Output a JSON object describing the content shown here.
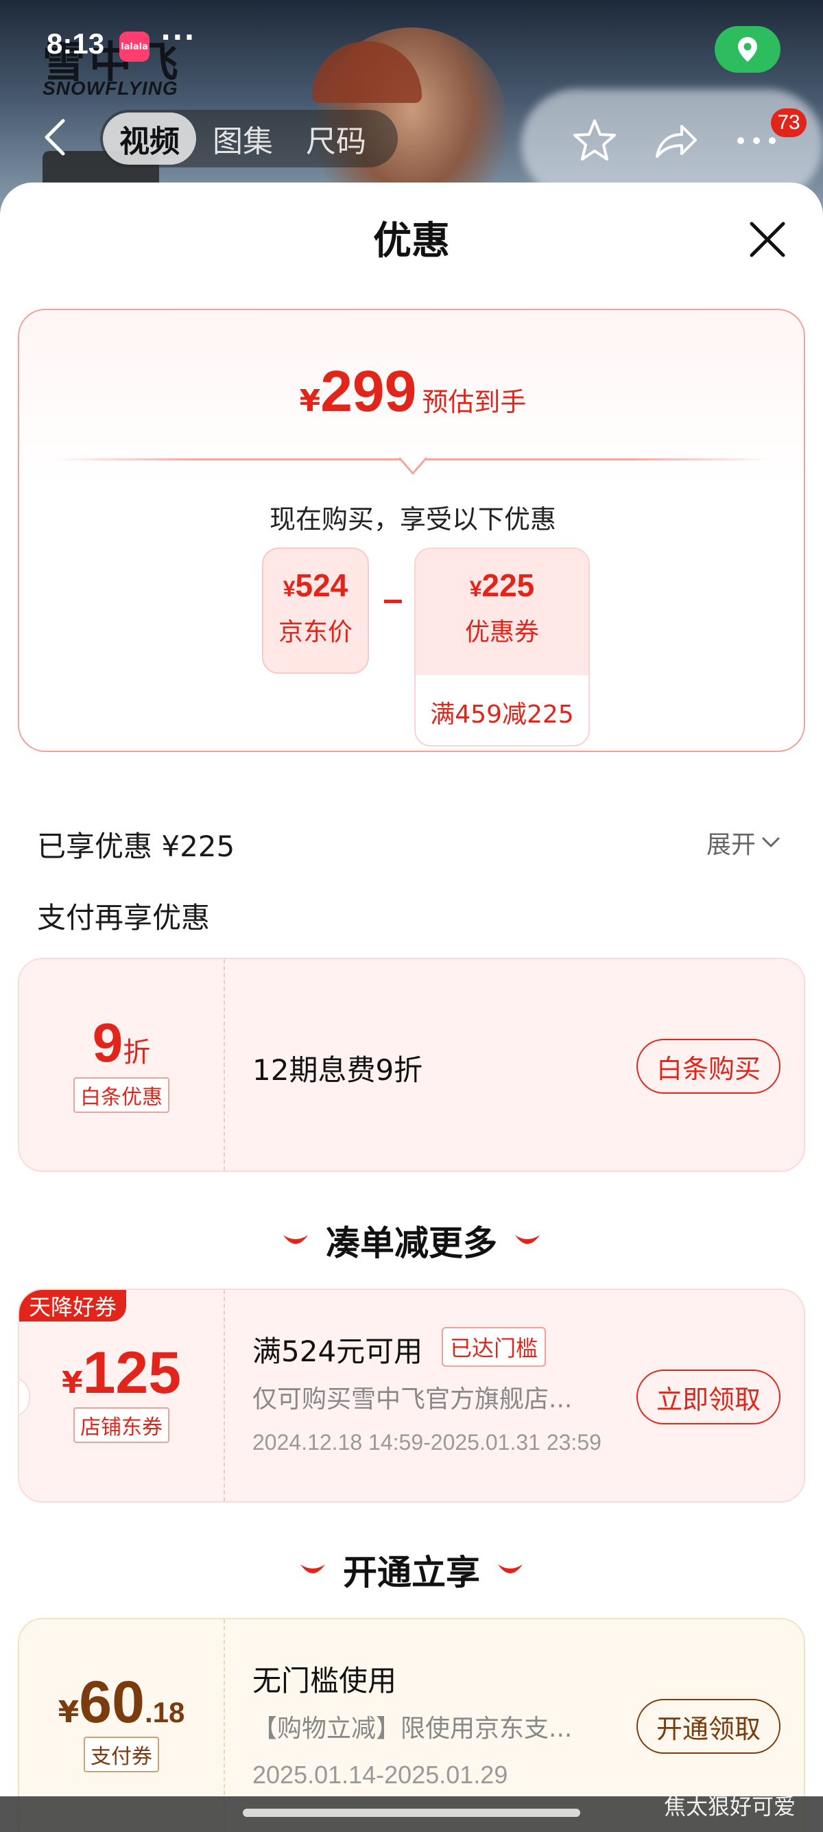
{
  "status_bar": {
    "time": "8:13",
    "app_icon_text": "lalala",
    "more": "···"
  },
  "brand": {
    "name_cn": "雪中飞",
    "name_en": "SNOWFLYING"
  },
  "nav": {
    "tabs": [
      {
        "label": "视频",
        "active": true
      },
      {
        "label": "图集"
      },
      {
        "label": "尺码"
      }
    ],
    "cart_count": "73"
  },
  "sheet": {
    "title": "优惠",
    "estimate": {
      "currency": "¥",
      "price": "299",
      "label": "预估到手"
    },
    "now_buy_text": "现在购买，享受以下优惠",
    "calc": {
      "jd_price": {
        "currency": "¥",
        "amount": "524",
        "label": "京东价"
      },
      "coupon": {
        "currency": "¥",
        "amount": "225",
        "label": "优惠券",
        "condition": "满459减225"
      }
    },
    "enjoyed": "已享优惠 ¥225",
    "expand_label": "展开",
    "pay_more": "支付再享优惠"
  },
  "baitiao": {
    "discount": "9",
    "discount_unit": "折",
    "tag": "白条优惠",
    "desc": "12期息费9折",
    "button": "白条购买"
  },
  "section_more": {
    "title": "凑单减更多"
  },
  "shop_coupon": {
    "corner_tag": "天降好券",
    "currency": "¥",
    "amount": "125",
    "tag": "店铺东券",
    "title": "满524元可用",
    "badge": "已达门槛",
    "desc": "仅可购买雪中飞官方旗舰店...",
    "date": "2024.12.18 14:59-2025.01.31 23:59",
    "button": "立即领取"
  },
  "section_open": {
    "title": "开通立享"
  },
  "pay_coupon": {
    "currency": "¥",
    "amount_int": "60",
    "amount_dec": ".18",
    "tag": "支付券",
    "title": "无门槛使用",
    "desc": "【购物立减】限使用京东支...",
    "date": "2025.01.14-2025.01.29",
    "button": "开通领取"
  },
  "watermark": "焦太狠好可爱",
  "colors": {
    "accent": "#e1251b",
    "gold": "#7a3b0e",
    "location": "#2ebd5e"
  }
}
